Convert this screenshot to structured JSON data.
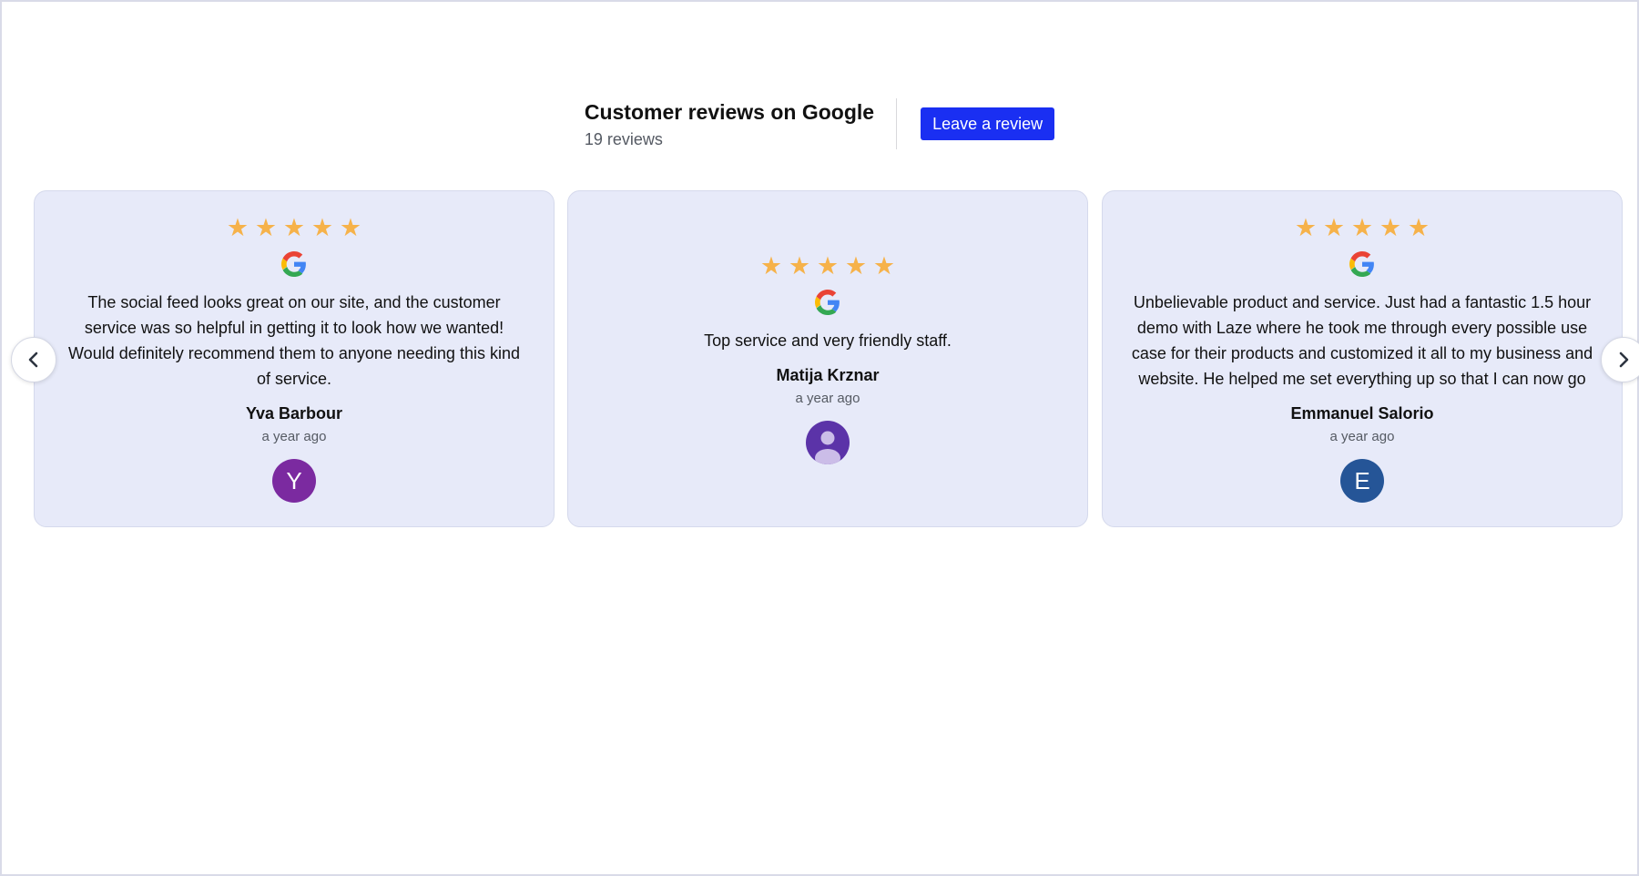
{
  "header": {
    "title": "Customer reviews on Google",
    "count": "19 reviews",
    "button_label": "Leave a review"
  },
  "colors": {
    "accent": "#1a2ff2",
    "card_bg": "#e7eaf9",
    "star": "#f6b24a"
  },
  "icons": {
    "prev": "chevron-left-icon",
    "next": "chevron-right-icon",
    "star": "star-icon",
    "source": "google-g-icon",
    "default_avatar": "user-silhouette-icon"
  },
  "reviews": [
    {
      "rating": 5,
      "text": "The social feed looks great on our site, and the customer service was so helpful in getting it to look how we wanted! Would definitely recommend them to anyone needing this kind of service.",
      "name": "Yva Barbour",
      "date": "a year ago",
      "avatar_initial": "Y",
      "avatar_color": "#7b2aa0"
    },
    {
      "rating": 5,
      "text": "Top service and very friendly staff.",
      "name": "Matija Krznar",
      "date": "a year ago",
      "avatar_initial": "",
      "avatar_color": "#5b33a8"
    },
    {
      "rating": 5,
      "text": "Unbelievable product and service. Just had a fantastic 1.5 hour demo with Laze where he took me through every possible use case for their products and customized it all to my business and website. He helped me set everything up so that I can now go …",
      "name": "Emmanuel Salorio",
      "date": "a year ago",
      "avatar_initial": "E",
      "avatar_color": "#255597"
    }
  ]
}
